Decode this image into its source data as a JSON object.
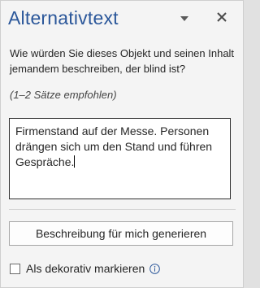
{
  "pane": {
    "title": "Alternativtext",
    "menu_icon": "chevron-down-icon",
    "close_icon": "close-icon"
  },
  "question": "Wie würden Sie dieses Objekt und seinen Inhalt jemandem beschreiben, der blind ist?",
  "hint": "(1–2 Sätze empfohlen)",
  "description": {
    "value": "Firmenstand auf der Messe. Personen drängen sich um den Stand und führen Gespräche."
  },
  "generate_button": {
    "label": "Beschreibung für mich generieren"
  },
  "decorative": {
    "label": "Als dekorativ markieren",
    "checked": false,
    "info_icon": "info-icon"
  },
  "colors": {
    "title": "#2b579a",
    "pane_background": "#f4f4f4",
    "info_icon": "#2b579a"
  }
}
